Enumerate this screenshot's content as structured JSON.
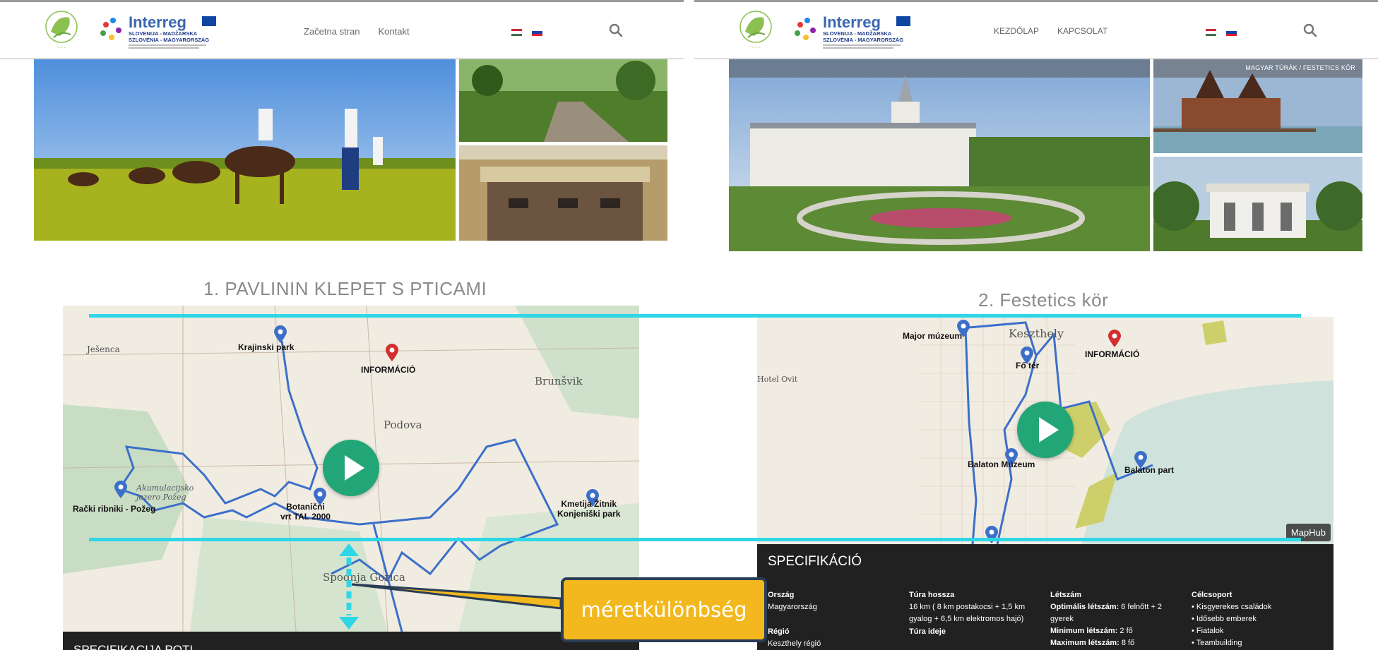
{
  "left_site": {
    "nav": [
      "Začetna stran",
      "Kontakt"
    ]
  },
  "right_site": {
    "nav": [
      "KEZDŐLAP",
      "KAPCSOLAT"
    ],
    "gallery_label": "MAGYAR TÚRÁK / FESTETICS KÖR"
  },
  "route1": {
    "title": "1. PAVLININ KLEPET S PTICAMI",
    "map_labels": {
      "krajinski": "Krajinski park",
      "informacio": "INFORMÁCIÓ",
      "botanicni": "Botanični\nvrt TAL 2000",
      "racki": "Rački ribniki - Požeg",
      "kmetija": "Kmetija Žitnik\nKonjeniški park"
    },
    "map_towns": {
      "jesenca": "Ješenca",
      "brunsvik": "Brunšvik",
      "podova": "Podova",
      "spodnja": "Spodnja Gorica",
      "akumulacija": "Akumulacijsko\njezero Požeg"
    },
    "spec_title": "SPECIFIKACIJA POTI"
  },
  "route2": {
    "title": "2. Festetics kör",
    "map_labels": {
      "major": "Major múzeum",
      "fo_ter": "Fő tér",
      "informacio": "INFORMÁCIÓ",
      "balaton_muzeum": "Balaton Múzeum",
      "balaton_part": "Balaton part"
    },
    "map_towns": {
      "keszthely": "Keszthely",
      "hotel": "Hotel Ovit"
    },
    "maphub": "MapHub",
    "spec_title": "SPECIFIKÁCIÓ",
    "spec_cols": [
      {
        "h1": "Ország",
        "v1": "Magyarország",
        "h2": "Régió",
        "v2": "Keszthely régió"
      },
      {
        "h1": "Túra hossza",
        "v1": "16 km ( 8 km postakocsi + 1,5 km gyalog + 6,5 km elektromos hajó)",
        "h2": "Túra ideje",
        "v2": ""
      },
      {
        "h1": "Létszám",
        "l1": "Optimális létszám:",
        "l1v": " 6 felnőtt + 2 gyerek",
        "l2": "Minimum létszám:",
        "l2v": " 2 fő",
        "l3": "Maximum létszám:",
        "l3v": " 8 fő"
      },
      {
        "h1": "Célcsoport",
        "items": [
          "• Kisgyerekes családok",
          "• Idősebb emberek",
          "• Fiatalok",
          "• Teambuilding"
        ]
      }
    ]
  },
  "annotation": {
    "callout": "méretkülönbség"
  },
  "colors": {
    "accent_cyan": "#2fd6e6",
    "play_green": "#23a677",
    "callout_yellow": "#f2b81d",
    "route_blue": "#3c6fc9"
  }
}
